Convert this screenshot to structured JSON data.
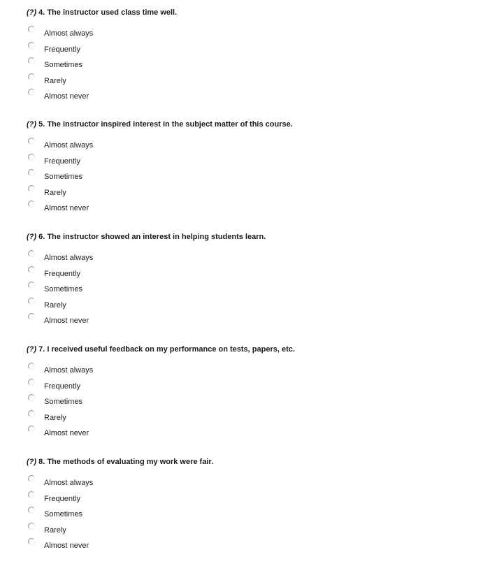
{
  "help_marker": "(?)",
  "options": [
    "Almost always",
    "Frequently",
    "Sometimes",
    "Rarely",
    "Almost never"
  ],
  "questions": [
    {
      "title": "4. The instructor used class time well.",
      "options": [
        "Almost always",
        "Frequently",
        "Sometimes",
        "Rarely",
        "Almost never"
      ]
    },
    {
      "title": "5. The instructor inspired interest in the subject matter of this course.",
      "options": [
        "Almost always",
        "Frequently",
        "Sometimes",
        "Rarely",
        "Almost never"
      ]
    },
    {
      "title": "6. The instructor showed an interest in helping students learn.",
      "options": [
        "Almost always",
        "Frequently",
        "Sometimes",
        "Rarely",
        "Almost never"
      ]
    },
    {
      "title": "7. I received useful feedback on my performance on tests, papers, etc.",
      "options": [
        "Almost always",
        "Frequently",
        "Sometimes",
        "Rarely",
        "Almost never"
      ]
    },
    {
      "title": "8. The methods of evaluating my work were fair.",
      "options": [
        "Almost always",
        "Frequently",
        "Sometimes",
        "Rarely",
        "Almost never"
      ]
    }
  ]
}
